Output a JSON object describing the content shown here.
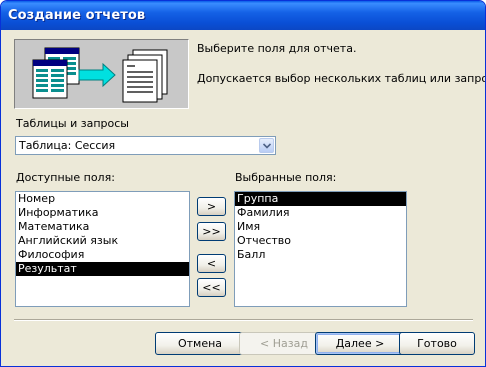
{
  "window": {
    "title": "Создание отчетов"
  },
  "intro": {
    "line1": "Выберите поля для отчета.",
    "line2": "Допускается выбор нескольких таблиц или запросов."
  },
  "source": {
    "label": "Таблицы и запросы",
    "value": "Таблица: Сессия"
  },
  "available": {
    "label": "Доступные поля:",
    "items": [
      "Номер",
      "Информатика",
      "Математика",
      "Английский язык",
      "Философия",
      "Результат"
    ],
    "selected_index": 5
  },
  "chosen": {
    "label": "Выбранные поля:",
    "items": [
      "Группа",
      "Фамилия",
      "Имя",
      "Отчество",
      "Балл"
    ],
    "selected_index": 0
  },
  "move_buttons": {
    "add_one": ">",
    "add_all": ">>",
    "remove_one": "<",
    "remove_all": "<<"
  },
  "footer": {
    "cancel": "Отмена",
    "back": "< Назад",
    "next": "Далее >",
    "finish": "Готово"
  }
}
